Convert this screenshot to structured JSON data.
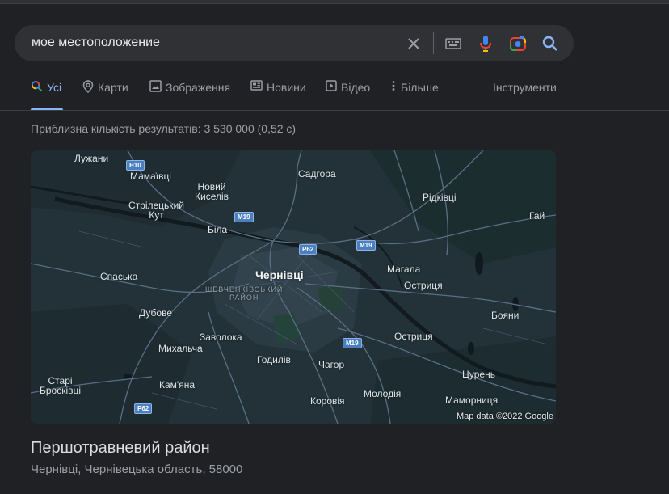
{
  "search": {
    "query": "мое местоположение"
  },
  "tabs": [
    {
      "label": "Усі",
      "icon": "search-icon",
      "active": true
    },
    {
      "label": "Карти",
      "icon": "map-pin-icon"
    },
    {
      "label": "Зображення",
      "icon": "image-icon"
    },
    {
      "label": "Новини",
      "icon": "news-icon"
    },
    {
      "label": "Відео",
      "icon": "video-icon"
    },
    {
      "label": "Більше",
      "icon": "more-vert-icon"
    }
  ],
  "tools_label": "Інструменти",
  "result_stats": "Приблизна кількість результатів: 3 530 000 (0,52 с)",
  "map": {
    "credit": "Map data ©2022 Google",
    "labels": {
      "luzhany": "Лужани",
      "mamaivtsi": "Мамаївці",
      "sadhora": "Садгора",
      "novyi_kyseliv": "Новий\nКиселів",
      "ridkivtsi": "Рідківці",
      "striletskyi_kut": "Стрілецький\nКут",
      "hai": "Гай",
      "bila": "Біла",
      "mahala": "Магала",
      "spaska": "Спаська",
      "chernivtsi": "Чернівці",
      "shevchenkivskyi": "ШЕВЧЕНКІВСЬКИЙ\nРАЙОН",
      "ostrytsia1": "Остриця",
      "dubove": "Дубове",
      "boiany": "Бояни",
      "zavolokа": "Заволока",
      "ostrytsia2": "Остриця",
      "mykhalcha": "Михальча",
      "hodyliv": "Годилів",
      "chahor": "Чагор",
      "tsuren": "Цурень",
      "stari_broskivtsi": "Старі\nБросківці",
      "kamiana": "Кам'яна",
      "molodiia": "Молодія",
      "korovia": "Коровія",
      "mamornytsia": "Маморниця"
    },
    "shields": {
      "h10": "H10",
      "m19a": "M19",
      "p62a": "P62",
      "m19b": "M19",
      "m19c": "M19",
      "p62b": "P62"
    }
  },
  "place": {
    "title": "Першотравневий район",
    "address": "Чернівці, Чернівецька область, 58000"
  }
}
